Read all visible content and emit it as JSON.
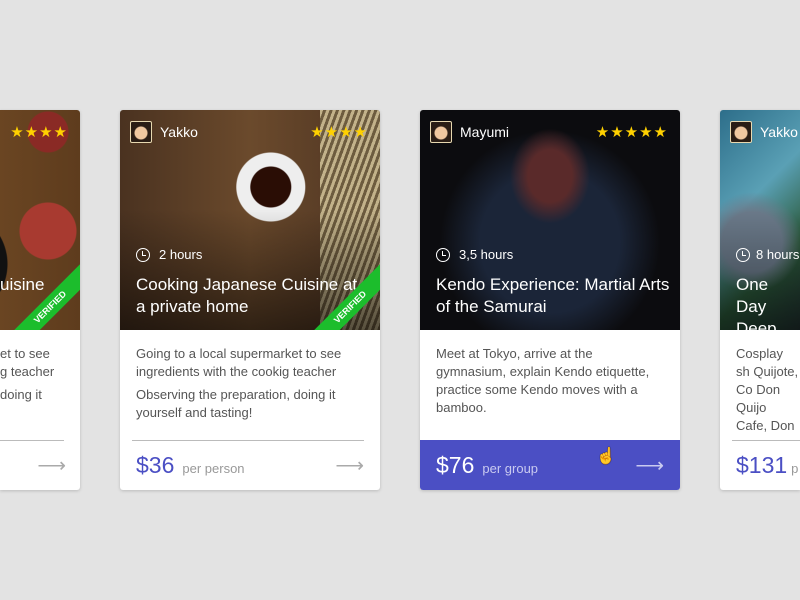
{
  "cards": [
    {
      "host": "",
      "stars": "★★★★",
      "duration": "",
      "title": "uisine",
      "verified": "VERIFIED",
      "desc": [
        "et to see",
        "g teacher",
        " doing it"
      ],
      "price": "",
      "unit": ""
    },
    {
      "host": "Yakko",
      "stars": "★★★★",
      "duration": "2 hours",
      "title": "Cooking Japanese Cuisine at a private home",
      "verified": "VERIFIED",
      "desc": [
        "Going to a local supermarket to see ingredients with the cookig teacher",
        "Observing the preparation, doing it yourself and tasting!"
      ],
      "price": "$36",
      "unit": "per person"
    },
    {
      "host": "Mayumi",
      "stars": "★★★★★",
      "duration": "3,5 hours",
      "title": "Kendo Experience: Martial Arts of the Samurai",
      "desc": [
        "Meet at Tokyo, arrive at the gymnasium,  explain Kendo etiquette, practice some Kendo moves with a bamboo."
      ],
      "price": "$76",
      "unit": "per group"
    },
    {
      "host": "Yakko",
      "duration": "8 hours",
      "title": "One Day Deep into",
      "desc": [
        "Cosplay sh Quijote, Co Don Quijo Cafe, Don"
      ],
      "price": "$131",
      "unit": "p"
    }
  ],
  "arrow_icon": "arrow-right-icon",
  "colors": {
    "accent": "#4b4fc4",
    "verified": "#1cbd2c",
    "star": "#ffd100"
  }
}
